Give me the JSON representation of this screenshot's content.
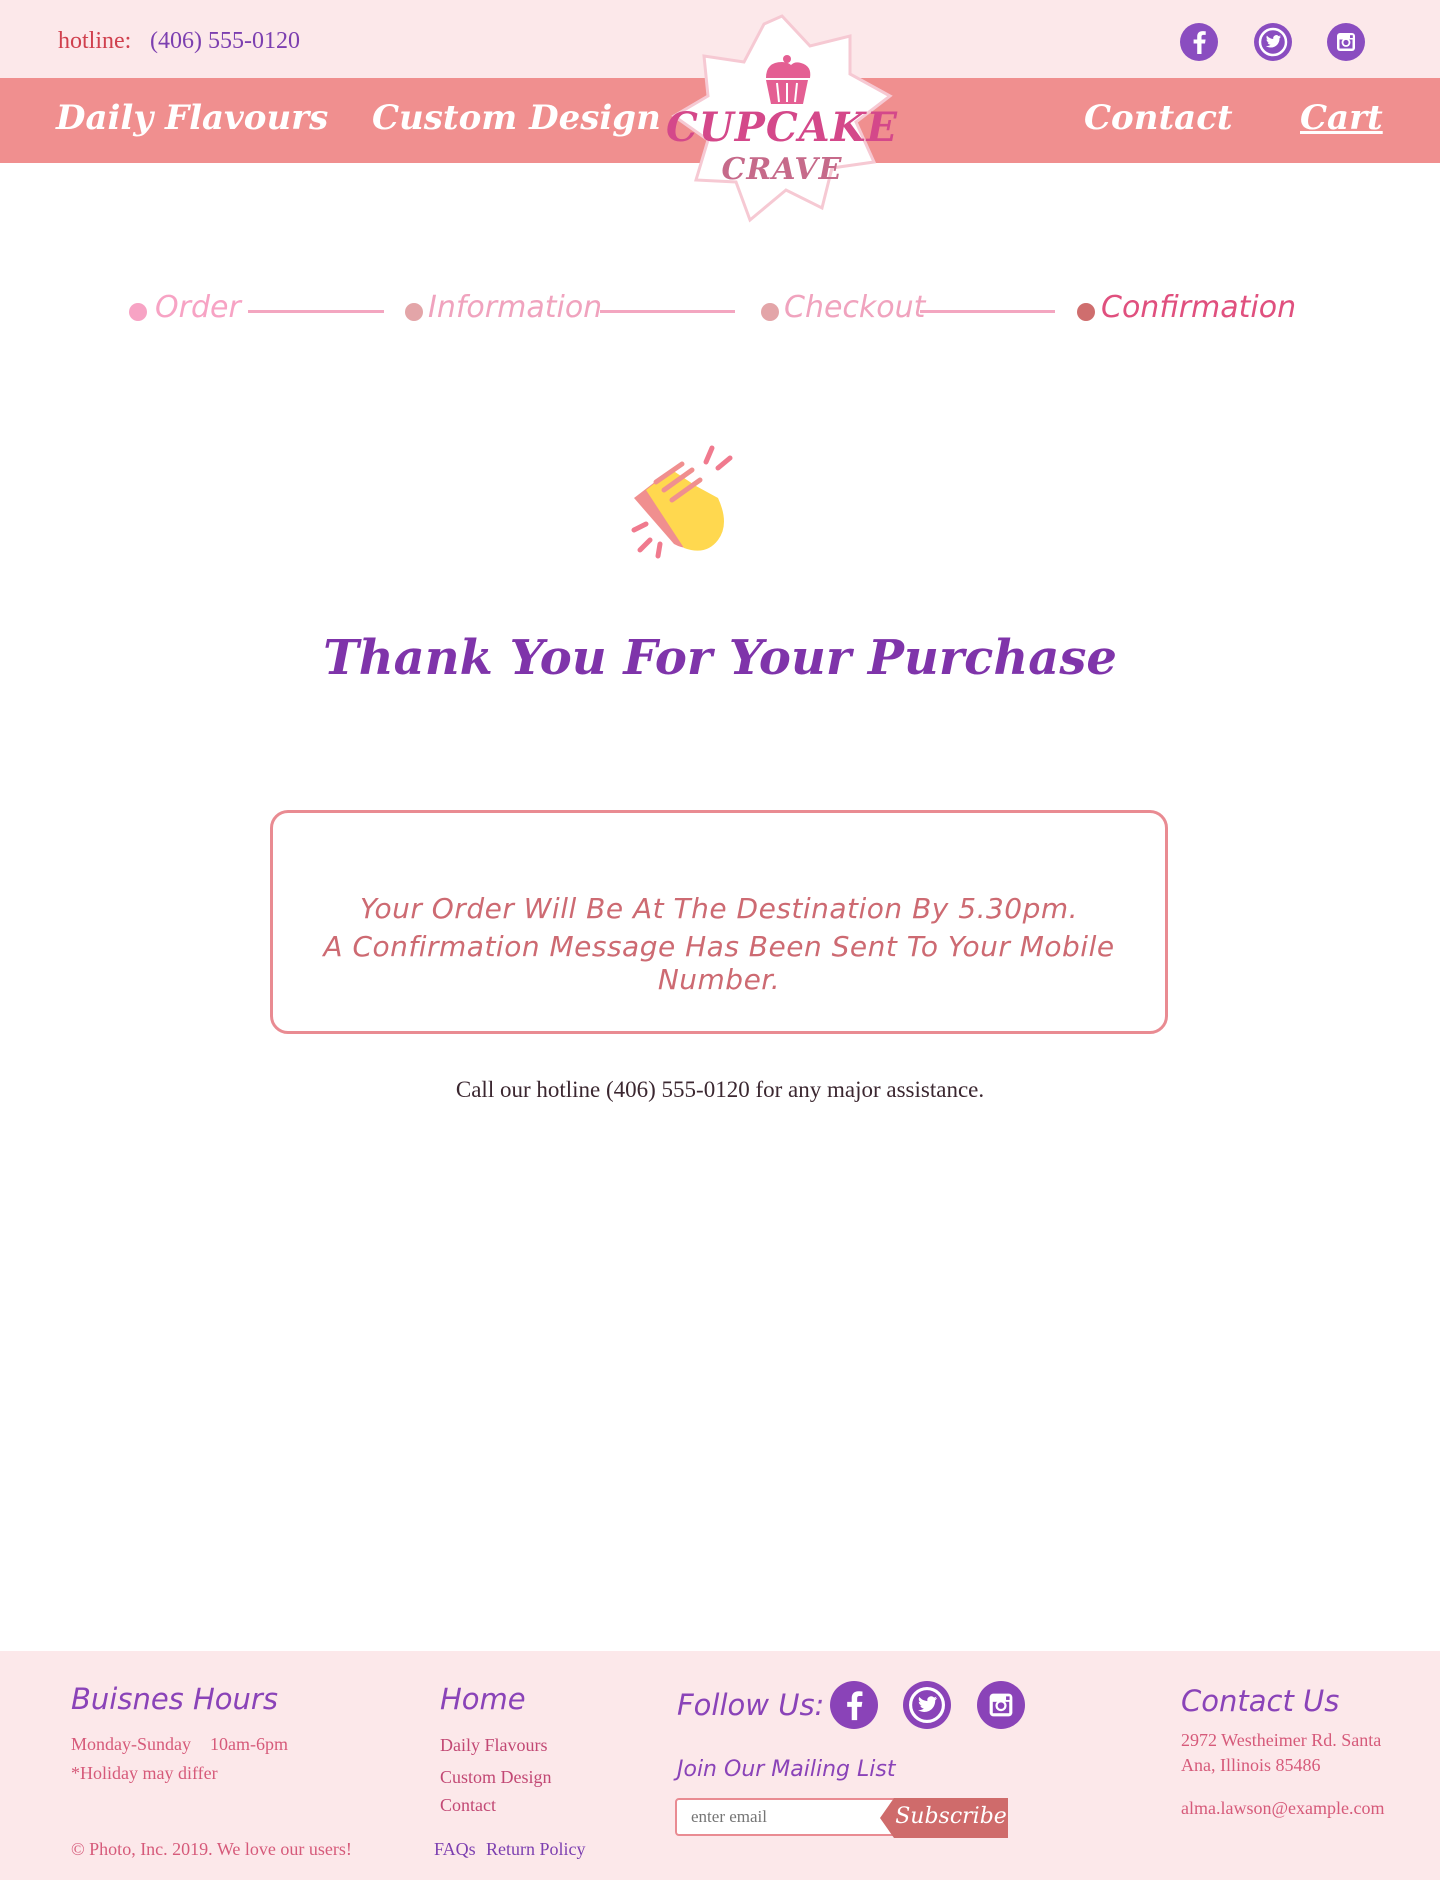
{
  "header": {
    "hotline_label": "hotline:",
    "hotline_number": "(406) 555-0120"
  },
  "nav": {
    "daily": "Daily Flavours",
    "custom": "Custom Design",
    "contact": "Contact",
    "cart": "Cart"
  },
  "logo": {
    "line1": "CUPCAKE",
    "line2": "CRAVE"
  },
  "steps": [
    {
      "label": "Order",
      "color": "#f7a3c4"
    },
    {
      "label": "Information",
      "color": "#e3a5a8"
    },
    {
      "label": "Checkout",
      "color": "#e3a5a8"
    },
    {
      "label": "Confirmation",
      "color": "#cf6e6e"
    }
  ],
  "main": {
    "icon": "clapping-hands-icon",
    "title": "Thank You For Your Purchase",
    "message_line1": "Your Order Will Be At The Destination By 5.30pm.",
    "message_line2": "A Confirmation Message Has Been Sent To Your Mobile Number.",
    "assistance": "Call our hotline (406) 555-0120 for any major assistance."
  },
  "footer": {
    "hours_title": "Buisnes Hours",
    "hours_days": "Monday-Sunday",
    "hours_time": "10am-6pm",
    "holiday_note": "*Holiday may differ",
    "copyright": "© Photo, Inc. 2019. We love our users!",
    "home_title": "Home",
    "home_links": [
      "Daily Flavours",
      "Custom Design",
      "Contact"
    ],
    "faqs": "FAQs",
    "return_policy": "Return Policy",
    "follow_title": "Follow Us:",
    "mailing_title": "Join Our Mailing List",
    "email_placeholder": "enter email",
    "subscribe": "Subscribe",
    "contact_title": "Contact Us",
    "address_line1": "2972 Westheimer Rd. Santa",
    "address_line2": "Ana, Illinois 85486",
    "email": "alma.lawson@example.com"
  },
  "colors": {
    "brand_pink": "#f08f8f",
    "brand_purple": "#7f34aa",
    "background_blush": "#fce8ea"
  }
}
